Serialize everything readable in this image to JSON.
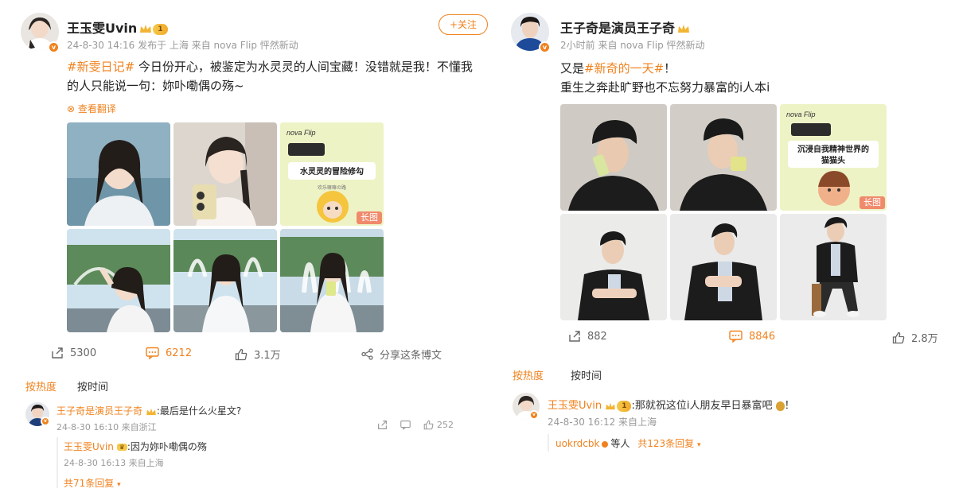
{
  "colors": {
    "accent": "#f0821e",
    "muted": "#999999",
    "text": "#222222"
  },
  "left": {
    "author": {
      "name": "王玉雯Uvin",
      "level": "1"
    },
    "meta": {
      "time": "24-8-30 14:16",
      "published": "发布于 上海",
      "source": "来自 nova Flip 怦然新动"
    },
    "follow_label": "+关注",
    "post": {
      "tag": "#新雯日记#",
      "text": " 今日份开心，被鉴定为水灵灵的人间宝藏！没错就是我！不懂我的人只能说一句：妳卟嘞偶の殇~"
    },
    "translate_label": "查看翻译",
    "promo": {
      "brand": "nova Flip",
      "title": "水灵灵的冒险修勾",
      "sub": "欢乐嘛嘛の路",
      "badge": "长图"
    },
    "actions": {
      "share": "5300",
      "comment": "6212",
      "like": "3.1万",
      "more": "分享这条博文"
    },
    "sort": {
      "hot": "按热度",
      "time": "按时间"
    },
    "comment": {
      "name": "王子奇是演员王子奇",
      "text": ":最后是什么火星文?",
      "meta": "24-8-30 16:10 来自浙江",
      "likes": "252",
      "reply": {
        "name": "王玉雯Uvin",
        "text": ":因为妳卟嘞偶の殇",
        "meta": "24-8-30 16:13 来自上海"
      },
      "more": "共71条回复"
    }
  },
  "right": {
    "author": {
      "name": "王子奇是演员王子奇"
    },
    "meta": {
      "time": "2小时前",
      "source": "来自 nova Flip 怦然新动"
    },
    "post": {
      "prefix": "又是",
      "tag": "#新奇的一天#",
      "suffix": "！",
      "line2": "重生之奔赴旷野也不忘努力暴富的i人本i"
    },
    "promo": {
      "brand": "nova Flip",
      "title": "沉浸自我精神世界的猫猫头",
      "badge": "长图"
    },
    "actions": {
      "share": "882",
      "comment": "8846",
      "like": "2.8万"
    },
    "sort": {
      "hot": "按热度",
      "time": "按时间"
    },
    "comment": {
      "name": "王玉雯Uvin",
      "level": "1",
      "text": ":那就祝这位i人朋友早日暴富吧",
      "suffix": "！",
      "meta": "24-8-30 16:12 来自上海",
      "repliers": "uokrdcbk",
      "others": "等人",
      "more": "共123条回复"
    }
  }
}
